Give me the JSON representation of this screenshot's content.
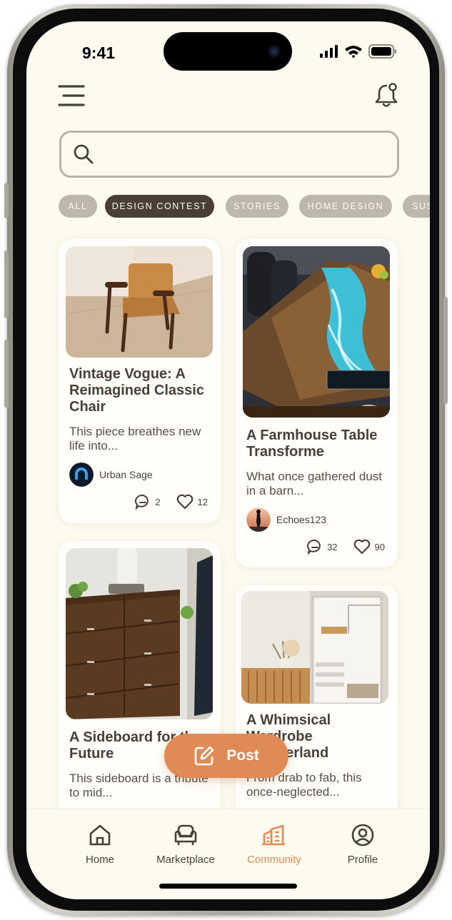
{
  "status_bar": {
    "time": "9:41"
  },
  "search": {
    "placeholder": "",
    "value": ""
  },
  "filters": [
    {
      "label": "ALL",
      "active": false
    },
    {
      "label": "DESIGN CONTEST",
      "active": true
    },
    {
      "label": "STORIES",
      "active": false
    },
    {
      "label": "HOME DESIGN",
      "active": false
    },
    {
      "label": "SUS",
      "active": false
    }
  ],
  "posts": [
    {
      "title": "Vintage Vogue: A Reimagined Classic Chair",
      "excerpt": "This piece breathes new life into...",
      "author": "Urban Sage",
      "comments": "2",
      "likes": "12"
    },
    {
      "title": "A Farmhouse Table Transforme",
      "excerpt": "What once gathered dust in a barn...",
      "author": "Echoes123",
      "comments": "32",
      "likes": "90"
    },
    {
      "title": "A Sideboard for the Future",
      "excerpt": "This sideboard is a tribute to mid...",
      "author": "",
      "comments": "",
      "likes": ""
    },
    {
      "title": "A Whimsical Wardrobe Wonderland",
      "excerpt": "From drab to fab, this once-neglected...",
      "author": "",
      "comments": "",
      "likes": ""
    }
  ],
  "fab": {
    "label": "Post"
  },
  "tabs": [
    {
      "label": "Home",
      "icon": "home-icon",
      "active": false
    },
    {
      "label": "Marketplace",
      "icon": "armchair-icon",
      "active": false
    },
    {
      "label": "Community",
      "icon": "building-icon",
      "active": true
    },
    {
      "label": "Profile",
      "icon": "profile-icon",
      "active": false
    }
  ],
  "colors": {
    "accent": "#e08a55",
    "text": "#4a3f35",
    "background": "#fdfbef",
    "chip_inactive": "#bdb7ad"
  }
}
